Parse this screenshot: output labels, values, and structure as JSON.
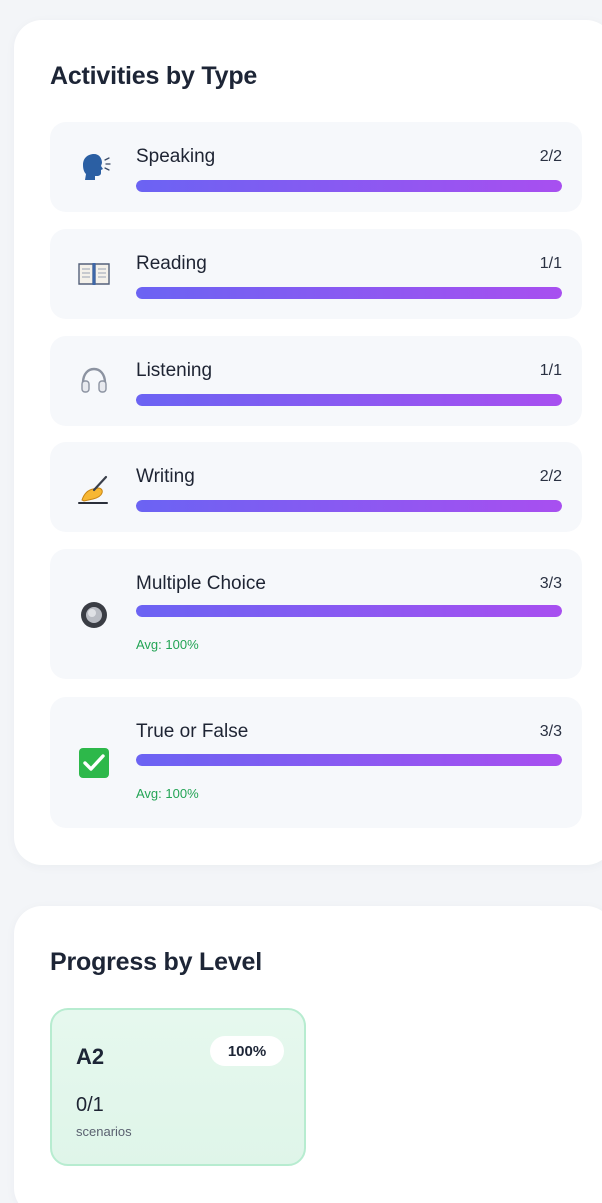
{
  "activities_section": {
    "title": "Activities by Type",
    "items": [
      {
        "name": "Speaking",
        "count": "2/2",
        "progress": 1.0,
        "icon": "speaking-head-icon",
        "avg": null
      },
      {
        "name": "Reading",
        "count": "1/1",
        "progress": 1.0,
        "icon": "open-book-icon",
        "avg": null
      },
      {
        "name": "Listening",
        "count": "1/1",
        "progress": 1.0,
        "icon": "headphones-icon",
        "avg": null
      },
      {
        "name": "Writing",
        "count": "2/2",
        "progress": 1.0,
        "icon": "writing-hand-icon",
        "avg": null
      },
      {
        "name": "Multiple Choice",
        "count": "3/3",
        "progress": 1.0,
        "icon": "radio-button-icon",
        "avg": "Avg: 100%"
      },
      {
        "name": "True or False",
        "count": "3/3",
        "progress": 1.0,
        "icon": "check-mark-box-icon",
        "avg": "Avg: 100%"
      }
    ]
  },
  "levels_section": {
    "title": "Progress by Level",
    "levels": [
      {
        "name": "A2",
        "percent": "100%",
        "count": "0/1",
        "unit": "scenarios"
      }
    ]
  },
  "colors": {
    "progress_start": "#6b63f3",
    "progress_end": "#a84ff0",
    "avg_text": "#23a455",
    "level_card_bg": "#e6f8ee",
    "accent_line": "#7c3aed"
  }
}
